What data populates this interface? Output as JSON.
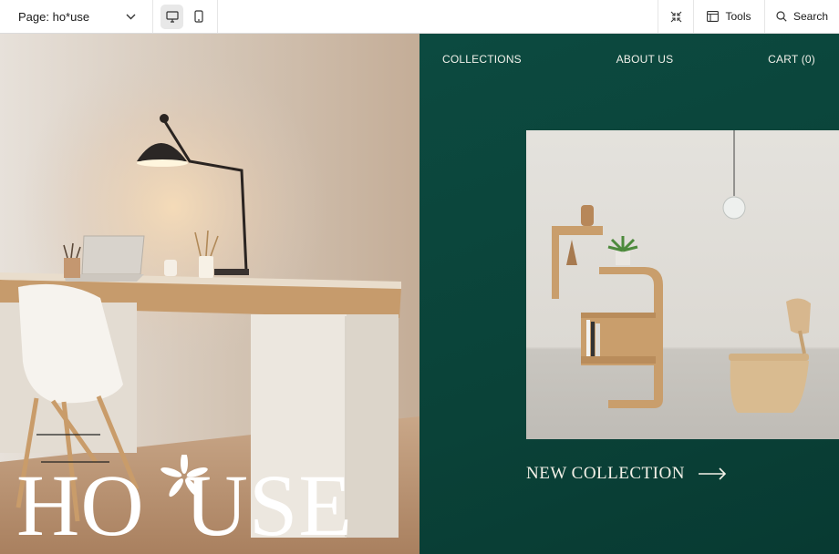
{
  "toolbar": {
    "page_label": "Page: ho*use",
    "tools_label": "Tools",
    "search_label": "Search",
    "devices": [
      "desktop",
      "mobile"
    ],
    "active_device": "desktop"
  },
  "site": {
    "nav": {
      "collections": "COLLECTIONS",
      "about": "ABOUT US",
      "cart": "CART (0)"
    },
    "brand_left": "HO",
    "brand_right": "USE",
    "cta_label": "NEW COLLECTION"
  },
  "colors": {
    "panel_green": "#0c4a40",
    "text_light": "#f1f1ea"
  }
}
